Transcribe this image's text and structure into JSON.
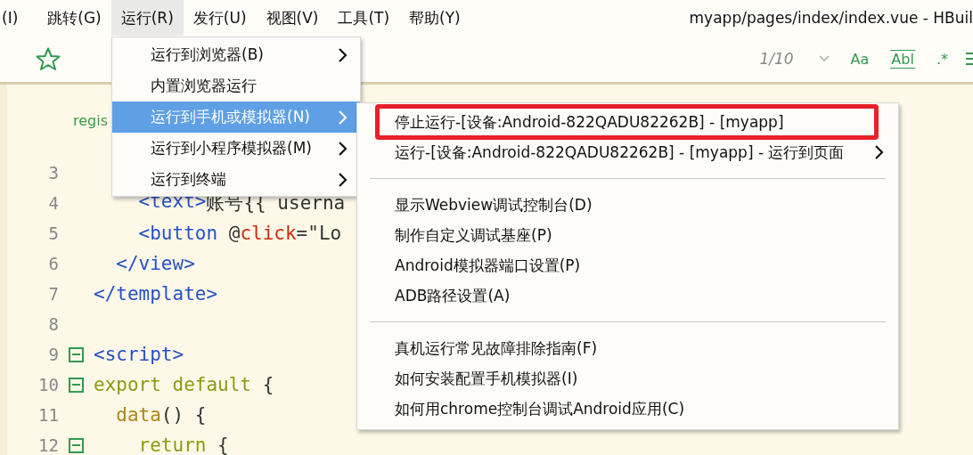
{
  "menubar": {
    "items": [
      {
        "label": "(I)",
        "selected": false
      },
      {
        "label": "跳转(G)",
        "selected": false
      },
      {
        "label": "运行(R)",
        "selected": true
      },
      {
        "label": "发行(U)",
        "selected": false
      },
      {
        "label": "视图(V)",
        "selected": false
      },
      {
        "label": "工具(T)",
        "selected": false
      },
      {
        "label": "帮助(Y)",
        "selected": false
      }
    ],
    "title": "myapp/pages/index/index.vue - HBuil"
  },
  "search": {
    "count": "1/10",
    "options": [
      {
        "label": "Aa",
        "kind": "plain"
      },
      {
        "label": "Abl",
        "kind": "boxed"
      },
      {
        "label": ".*",
        "kind": "plain"
      }
    ]
  },
  "editor": {
    "hint": "regis",
    "lines": [
      {
        "number": "3",
        "fold": false
      },
      {
        "number": "4",
        "fold": false,
        "tokens": [
          {
            "text": "    <text>",
            "kind": "tag"
          },
          {
            "text": "账号{{ userna",
            "kind": "text"
          }
        ]
      },
      {
        "number": "5",
        "fold": false,
        "tokens": [
          {
            "text": "    <button ",
            "kind": "tag"
          },
          {
            "text": "@",
            "kind": "text"
          },
          {
            "text": "click",
            "kind": "attr"
          },
          {
            "text": "=\"Lo",
            "kind": "text"
          }
        ]
      },
      {
        "number": "6",
        "fold": false,
        "tokens": [
          {
            "text": "  </view>",
            "kind": "tag"
          }
        ]
      },
      {
        "number": "7",
        "fold": false,
        "tokens": [
          {
            "text": "</template>",
            "kind": "tag"
          }
        ]
      },
      {
        "number": "8",
        "fold": false
      },
      {
        "number": "9",
        "fold": true,
        "tokens": [
          {
            "text": "<script>",
            "kind": "tag"
          }
        ]
      },
      {
        "number": "10",
        "fold": true,
        "tokens": [
          {
            "text": "export default",
            "kind": "keyword"
          },
          {
            "text": " {",
            "kind": "text"
          }
        ]
      },
      {
        "number": "11",
        "fold": false,
        "tokens": [
          {
            "text": "  data",
            "kind": "func"
          },
          {
            "text": "() {",
            "kind": "text"
          }
        ]
      },
      {
        "number": "12",
        "fold": true,
        "tokens": [
          {
            "text": "    return",
            "kind": "keyword"
          },
          {
            "text": " {",
            "kind": "text"
          }
        ]
      }
    ]
  },
  "run_menu": {
    "items": [
      {
        "label": "运行到浏览器(B)",
        "submenu": true,
        "selected": false
      },
      {
        "label": "内置浏览器运行",
        "submenu": false,
        "selected": false
      },
      {
        "label": "运行到手机或模拟器(N)",
        "submenu": true,
        "selected": true
      },
      {
        "label": "运行到小程序模拟器(M)",
        "submenu": true,
        "selected": false
      },
      {
        "label": "运行到终端",
        "submenu": true,
        "selected": false
      }
    ],
    "submenu": {
      "items": [
        {
          "kind": "item",
          "label": "停止运行-[设备:Android-822QADU82262B] - [myapp]",
          "submenu": false,
          "annotated": true
        },
        {
          "kind": "item",
          "label": "运行-[设备:Android-822QADU82262B] - [myapp] - 运行到页面",
          "submenu": true,
          "annotated": false
        },
        {
          "kind": "separator"
        },
        {
          "kind": "item",
          "label": "显示Webview调试控制台(D)",
          "submenu": false,
          "annotated": false
        },
        {
          "kind": "item",
          "label": "制作自定义调试基座(P)",
          "submenu": false,
          "annotated": false
        },
        {
          "kind": "item",
          "label": "Android模拟器端口设置(P)",
          "submenu": false,
          "annotated": false
        },
        {
          "kind": "item",
          "label": "ADB路径设置(A)",
          "submenu": false,
          "annotated": false
        },
        {
          "kind": "separator"
        },
        {
          "kind": "item",
          "label": "真机运行常见故障排除指南(F)",
          "submenu": false,
          "annotated": false
        },
        {
          "kind": "item",
          "label": "如何安装配置手机模拟器(I)",
          "submenu": false,
          "annotated": false
        },
        {
          "kind": "item",
          "label": "如何用chrome控制台调试Android应用(C)",
          "submenu": false,
          "annotated": false
        }
      ]
    }
  }
}
